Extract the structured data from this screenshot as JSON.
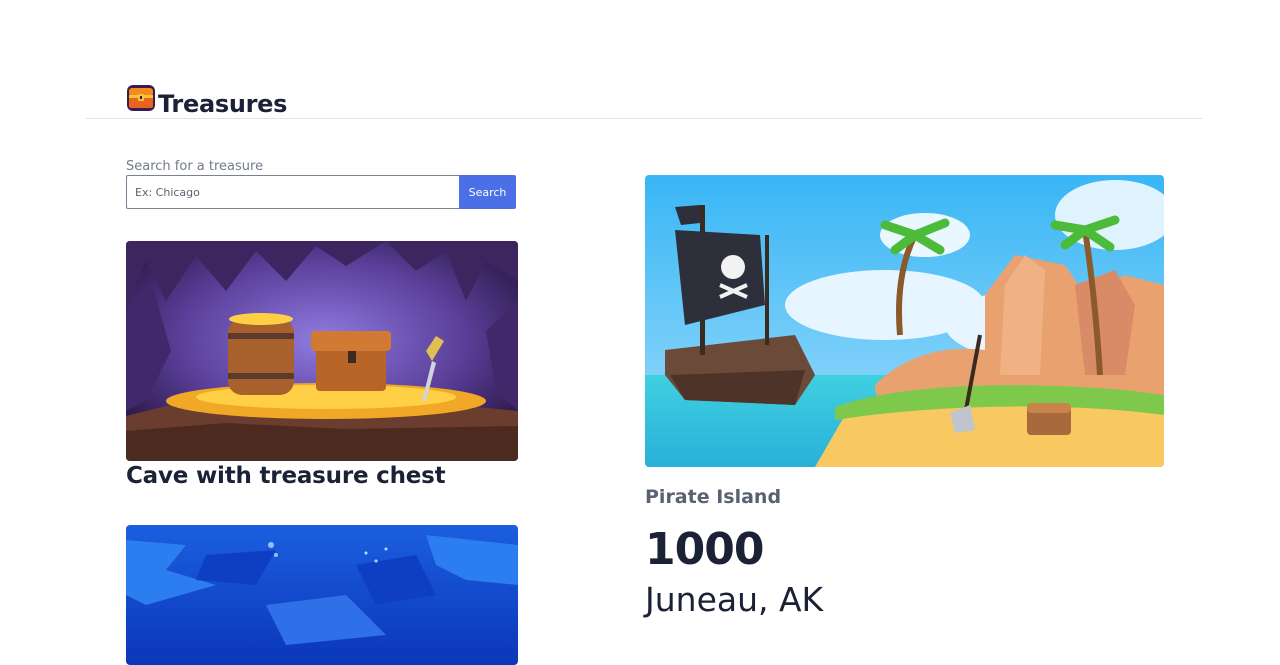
{
  "header": {
    "brand": "Treasures",
    "logo_icon": "treasure-chest-icon"
  },
  "search": {
    "label": "Search for a treasure",
    "placeholder": "Ex: Chicago",
    "value": "",
    "button_label": "Search"
  },
  "treasures": [
    {
      "title": "Cave with treasure chest",
      "image": "cave-treasure-image"
    },
    {
      "title": "",
      "image": "underwater-image"
    }
  ],
  "featured": {
    "image": "pirate-island-image",
    "name": "Pirate Island",
    "value": "1000",
    "location": "Juneau, AK"
  },
  "colors": {
    "accent": "#4b6fe6",
    "text": "#1c2236",
    "muted": "#5a6170",
    "divider": "#dfe2e6"
  }
}
